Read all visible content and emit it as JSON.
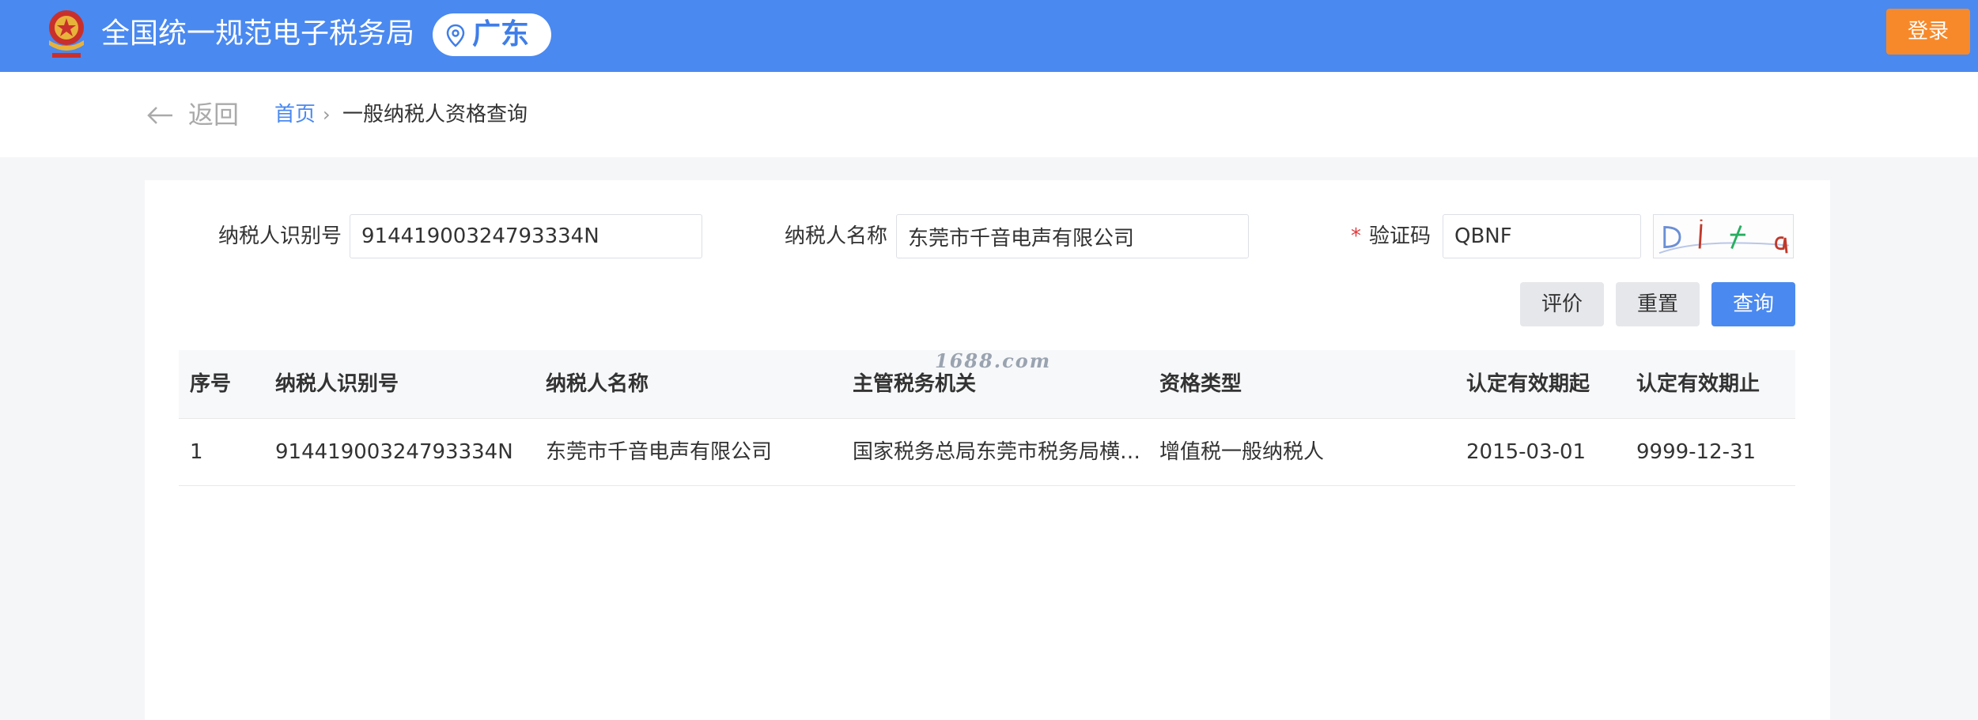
{
  "header": {
    "title": "全国统一规范电子税务局",
    "region": "广东",
    "login_label": "登录",
    "emblem_icon": "tax-emblem-icon",
    "brand_color": "#4a89f0",
    "login_color": "#f7892a"
  },
  "breadcrumb": {
    "back_label": "返回",
    "home": "首页",
    "separator": "›",
    "current": "一般纳税人资格查询"
  },
  "form": {
    "taxpayer_id_label": "纳税人识别号",
    "taxpayer_id_value": "91441900324793334N",
    "taxpayer_name_label": "纳税人名称",
    "taxpayer_name_value": "东莞市千音电声有限公司",
    "required_mark": "*",
    "captcha_label": "验证码",
    "captcha_value": "QBNF",
    "buttons": {
      "evaluate": "评价",
      "reset": "重置",
      "query": "查询"
    }
  },
  "watermark": "1688.com",
  "table": {
    "columns": [
      "序号",
      "纳税人识别号",
      "纳税人名称",
      "主管税务机关",
      "资格类型",
      "认定有效期起",
      "认定有效期止"
    ],
    "rows": [
      [
        "1",
        "91441900324793334N",
        "东莞市千音电声有限公司",
        "国家税务总局东莞市税务局横…",
        "增值税一般纳税人",
        "2015-03-01",
        "9999-12-31"
      ]
    ]
  }
}
